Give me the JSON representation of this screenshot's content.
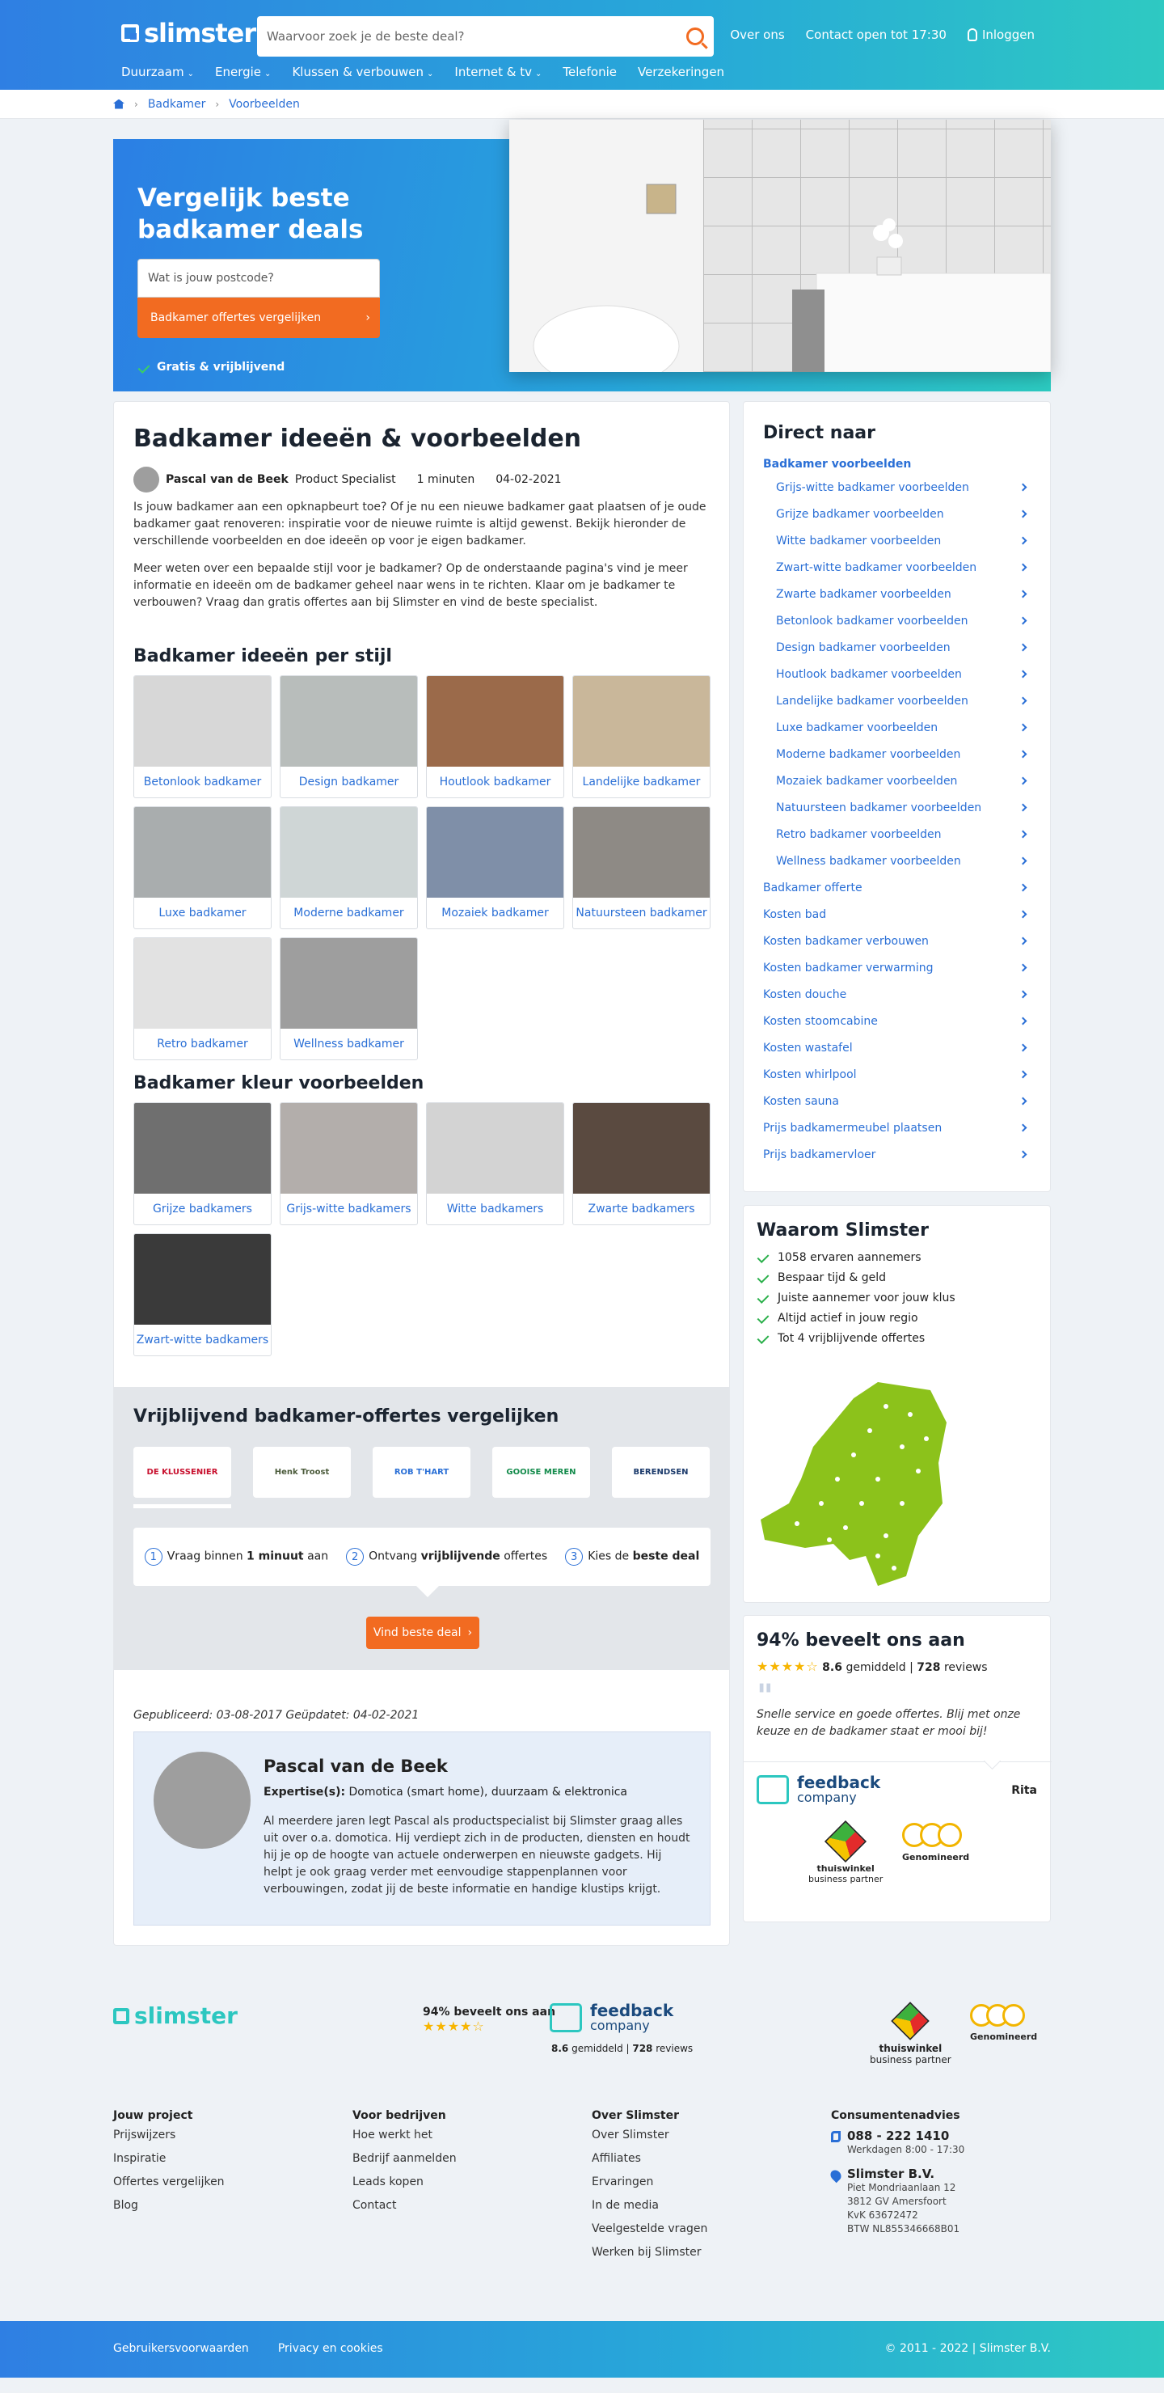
{
  "brand": {
    "name": "slimster",
    "accent": "#f26b21",
    "blue": "#2a6fd6",
    "teal": "#2cc7c0"
  },
  "header": {
    "search_placeholder": "Waarvoor zoek je de beste deal?",
    "links": [
      "Over ons",
      "Contact open tot 17:30",
      "Inloggen"
    ],
    "nav": [
      "Duurzaam",
      "Energie",
      "Klussen & verbouwen",
      "Internet & tv",
      "Telefonie",
      "Verzekeringen"
    ]
  },
  "breadcrumb": [
    "Badkamer",
    "Voorbeelden"
  ],
  "hero": {
    "title": "Vergelijk beste badkamer deals",
    "postcode_placeholder": "Wat is jouw postcode?",
    "cta": "Badkamer offertes vergelijken",
    "free": "Gratis & vrijblijvend"
  },
  "article": {
    "title": "Badkamer ideeën & voorbeelden",
    "author": "Pascal van de Beek",
    "role": "Product Specialist",
    "read_time": "1 minuten",
    "date": "04-02-2021",
    "intro1": "Is jouw badkamer aan een opknapbeurt toe? Of je nu een nieuwe badkamer gaat plaatsen of je oude badkamer gaat renoveren: inspiratie voor de nieuwe ruimte is altijd gewenst. Bekijk hieronder de verschillende voorbeelden en doe ideeën op voor je eigen badkamer.",
    "intro2": "Meer weten over een bepaalde stijl voor je badkamer? Op de onderstaande pagina's vind je meer informatie en ideeën om de badkamer geheel naar wens in te richten. Klaar om je badkamer te verbouwen? Vraag dan gratis offertes aan bij Slimster en vind de beste specialist.",
    "style_heading": "Badkamer ideeën per stijl",
    "styles": [
      "Betonlook badkamer",
      "Design badkamer",
      "Houtlook badkamer",
      "Landelijke badkamer",
      "Luxe badkamer",
      "Moderne badkamer",
      "Mozaiek badkamer",
      "Natuursteen badkamer",
      "Retro badkamer",
      "Wellness badkamer"
    ],
    "color_heading": "Badkamer kleur voorbeelden",
    "colors": [
      "Grijze badkamers",
      "Grijs-witte badkamers",
      "Witte badkamers",
      "Zwarte badkamers",
      "Zwart-witte badkamers"
    ]
  },
  "offers": {
    "heading": "Vrijblijvend badkamer-offertes vergelijken",
    "companies": [
      "DE KLUSSENIER",
      "Henk Troost",
      "ROB T'HART",
      "GOOISE MEREN",
      "BERENDSEN"
    ],
    "steps": [
      {
        "n": "1",
        "pre": "Vraag binnen ",
        "bold": "1 minuut",
        "post": " aan"
      },
      {
        "n": "2",
        "pre": "Ontvang ",
        "bold": "vrijblijvende",
        "post": " offertes"
      },
      {
        "n": "3",
        "pre": "Kies de ",
        "bold": "beste deal",
        "post": ""
      }
    ],
    "cta": "Vind beste deal"
  },
  "published": "Gepubliceerd: 03-08-2017  Geüpdatet: 04-02-2021",
  "bio": {
    "name": "Pascal van de Beek",
    "expertise_label": "Expertise(s):",
    "expertise": "Domotica (smart home), duurzaam & elektronica",
    "text": "Al meerdere jaren legt Pascal als productspecialist bij Slimster graag alles uit over o.a. domotica. Hij verdiept zich in de producten, diensten en houdt hij je op de hoogte van actuele onderwerpen en nieuwste gadgets. Hij helpt je ook graag verder met eenvoudige stappenplannen voor verbouwingen, zodat jij de beste informatie en handige klustips krijgt."
  },
  "direct": {
    "heading": "Direct naar",
    "section": "Badkamer voorbeelden",
    "sub": [
      "Grijs-witte badkamer voorbeelden",
      "Grijze badkamer voorbeelden",
      "Witte badkamer voorbeelden",
      "Zwart-witte badkamer voorbeelden",
      "Zwarte badkamer voorbeelden",
      "Betonlook badkamer voorbeelden",
      "Design badkamer voorbeelden",
      "Houtlook badkamer voorbeelden",
      "Landelijke badkamer voorbeelden",
      "Luxe badkamer voorbeelden",
      "Moderne badkamer voorbeelden",
      "Mozaiek badkamer voorbeelden",
      "Natuursteen badkamer voorbeelden",
      "Retro badkamer voorbeelden",
      "Wellness badkamer voorbeelden"
    ],
    "main": [
      "Badkamer offerte",
      "Kosten bad",
      "Kosten badkamer verbouwen",
      "Kosten badkamer verwarming",
      "Kosten douche",
      "Kosten stoomcabine",
      "Kosten wastafel",
      "Kosten whirlpool",
      "Kosten sauna",
      "Prijs badkamermeubel plaatsen",
      "Prijs badkamervloer"
    ]
  },
  "waarom": {
    "heading": "Waarom Slimster",
    "items": [
      "1058 ervaren aannemers",
      "Bespaar tijd & geld",
      "Juiste aannemer voor jouw klus",
      "Altijd actief in jouw regio",
      "Tot 4 vrijblijvende offertes"
    ]
  },
  "review": {
    "heading": "94% beveelt ons aan",
    "score": "8.6",
    "score_label": "gemiddeld",
    "reviews": "728",
    "reviews_label": "reviews",
    "quote": "Snelle service en goede offertes. Blij met onze keuze en de badkamer staat er mooi bij!",
    "reviewer": "Rita",
    "fb1": "feedback",
    "fb2": "company",
    "tw1": "thuiswinkel",
    "tw2": "business partner",
    "genom": "Genomineerd"
  },
  "footer": {
    "logo": "slimster",
    "beveelt": "94% beveelt ons aan",
    "cols": [
      {
        "title": "Jouw project",
        "items": [
          "Prijswijzers",
          "Inspiratie",
          "Offertes vergelijken",
          "Blog"
        ]
      },
      {
        "title": "Voor bedrijven",
        "items": [
          "Hoe werkt het",
          "Bedrijf aanmelden",
          "Leads kopen",
          "Contact"
        ]
      },
      {
        "title": "Over Slimster",
        "items": [
          "Over Slimster",
          "Affiliates",
          "Ervaringen",
          "In de media",
          "Veelgestelde vragen",
          "Werken bij Slimster"
        ]
      }
    ],
    "contact_title": "Consumentenadvies",
    "phone": "088 - 222 1410",
    "hours": "Werkdagen 8:00 - 17:30",
    "company": "Slimster B.V.",
    "address": [
      "Piet Mondriaanlaan 12",
      "3812 GV Amersfoort",
      "KvK 63672472",
      "BTW NL855346668B01"
    ],
    "bottom_links": [
      "Gebruikersvoorwaarden",
      "Privacy en cookies"
    ],
    "copyright": "© 2011 - 2022 | Slimster B.V."
  }
}
